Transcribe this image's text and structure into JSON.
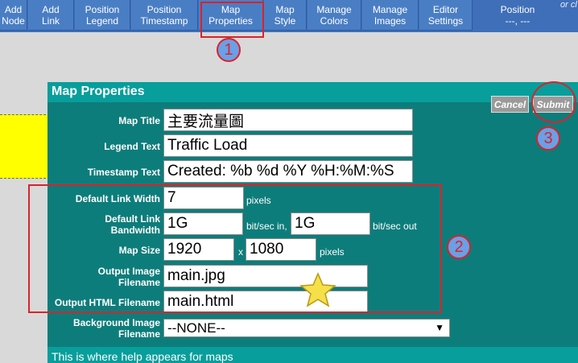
{
  "toolbar": {
    "buttons": [
      {
        "label": "Add\nNode"
      },
      {
        "label": "Add\nLink"
      },
      {
        "label": "Position\nLegend"
      },
      {
        "label": "Position\nTimestamp"
      },
      {
        "label": "Map\nProperties"
      },
      {
        "label": "Map\nStyle"
      },
      {
        "label": "Manage\nColors"
      },
      {
        "label": "Manage\nImages"
      },
      {
        "label": "Editor\nSettings"
      }
    ],
    "position_label": "Position\n---, ---",
    "or_text": "or cl"
  },
  "dialog": {
    "title": "Map Properties",
    "cancel_label": "Cancel",
    "submit_label": "Submit",
    "fields": {
      "map_title": {
        "label": "Map Title",
        "value": "主要流量圖"
      },
      "legend_text": {
        "label": "Legend Text",
        "value": "Traffic Load"
      },
      "timestamp_text": {
        "label": "Timestamp Text",
        "value": "Created: %b %d %Y %H:%M:%S"
      },
      "default_link_width": {
        "label": "Default Link Width",
        "value": "7",
        "unit": "pixels"
      },
      "default_link_bandwidth": {
        "label": "Default Link\nBandwidth",
        "in_value": "1G",
        "in_unit": "bit/sec in,",
        "out_value": "1G",
        "out_unit": "bit/sec out"
      },
      "map_size": {
        "label": "Map Size",
        "width": "1920",
        "sep": "x",
        "height": "1080",
        "unit": "pixels"
      },
      "output_image": {
        "label": "Output Image\nFilename",
        "value": "main.jpg"
      },
      "output_html": {
        "label": "Output HTML Filename",
        "value": "main.html"
      },
      "background_image": {
        "label": "Background Image\nFilename",
        "selected": "--NONE--"
      }
    },
    "help_text": "This is where help appears for maps"
  },
  "annotations": {
    "step1": "1",
    "step2": "2",
    "step3": "3",
    "color": "#d9232b"
  },
  "colors": {
    "toolbar": "#3f6fb8",
    "dialog_bg": "#0d7d7b",
    "titlebar": "#079e9b",
    "node": "#ffff00"
  }
}
